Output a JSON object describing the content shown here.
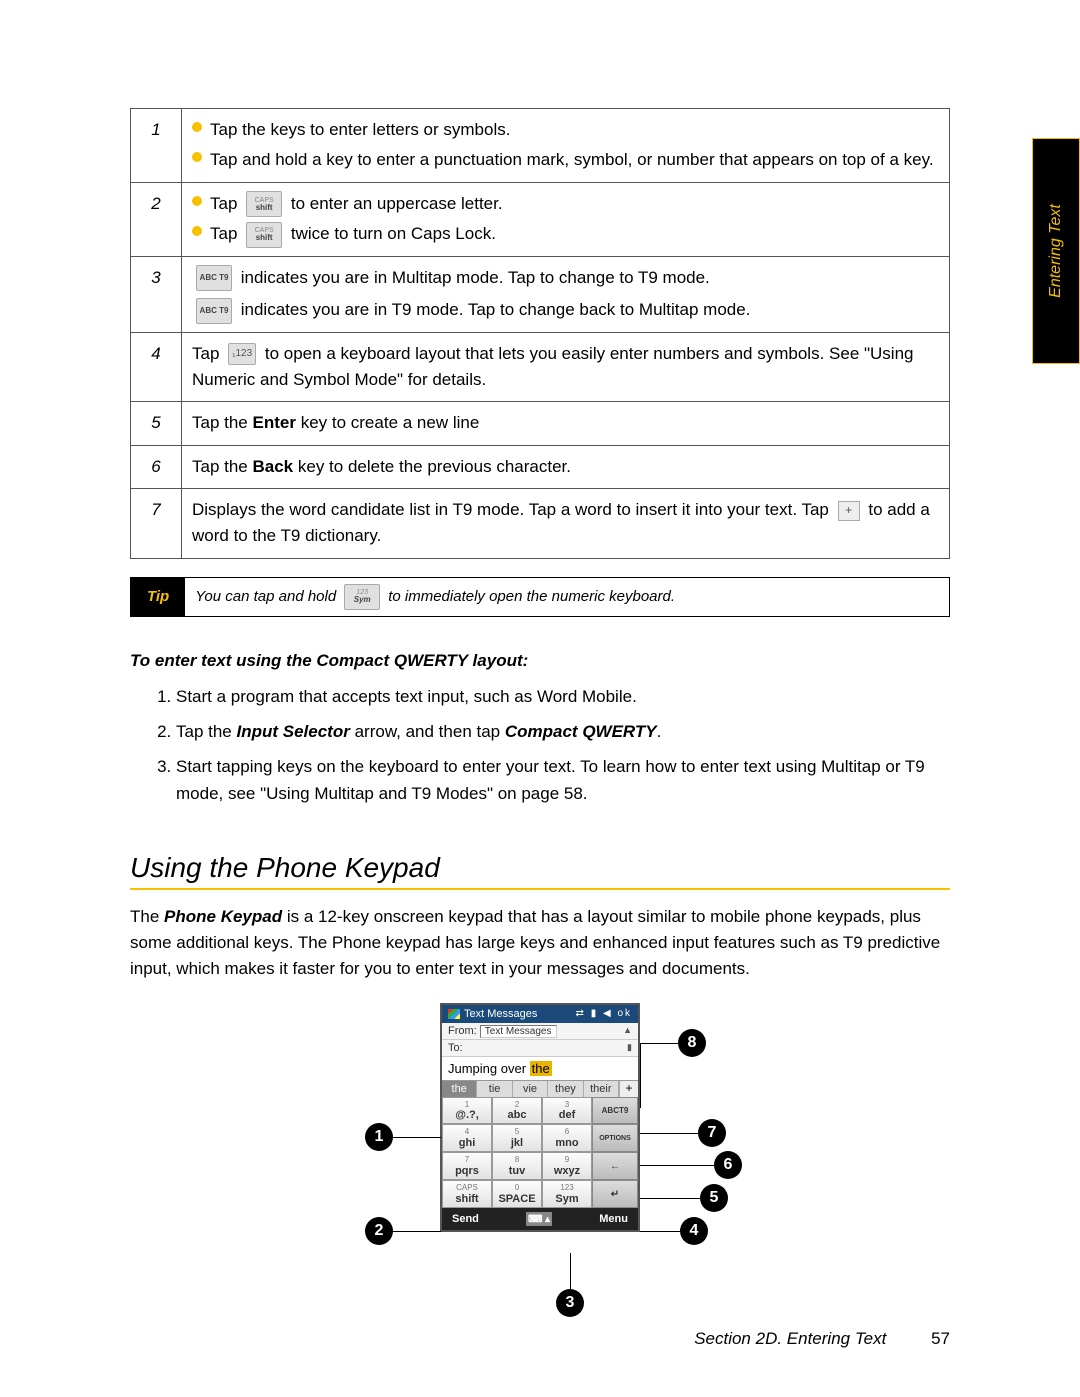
{
  "sidetab": "Entering Text",
  "table": {
    "rows": [
      {
        "num": "1",
        "bullets": [
          "Tap the keys to enter letters or symbols.",
          "Tap and hold a key to enter a punctuation mark, symbol, or number that appears on top of a key."
        ]
      },
      {
        "num": "2",
        "bullets_key": {
          "line1_pre": "Tap ",
          "key_top": "CAPS",
          "key_bot": "shift",
          "line1_post": " to enter an uppercase letter.",
          "line2_pre": "Tap ",
          "line2_post": " twice to turn on Caps Lock."
        }
      },
      {
        "num": "3",
        "mode": {
          "abc_label": "ABC T9",
          "line1": " indicates you are in Multitap mode. Tap to change to T9 mode.",
          "line2": " indicates you are in T9 mode. Tap to change back to Multitap mode."
        }
      },
      {
        "num": "4",
        "r4": {
          "pre": "Tap ",
          "key_label": "₁123",
          "mid": " to open a keyboard layout that lets you easily enter numbers and symbols. See \"Using Numeric and Symbol Mode\" for details."
        }
      },
      {
        "num": "5",
        "plain_pre": "Tap the ",
        "plain_b": "Enter",
        "plain_post": " key to create a new line"
      },
      {
        "num": "6",
        "plain_pre": "Tap the ",
        "plain_b": "Back",
        "plain_post": " key to delete the previous character."
      },
      {
        "num": "7",
        "r7": {
          "pre": "Displays the word candidate list in T9 mode. Tap a word to insert it into your text. Tap ",
          "plus": "+",
          "post": " to add a word to the T9 dictionary."
        }
      }
    ]
  },
  "tip": {
    "label": "Tip",
    "pre": "You can tap and hold ",
    "key_top": "123",
    "key_bot": "Sym",
    "post": " to immediately open the numeric keyboard."
  },
  "compact_heading": "To enter text using the Compact QWERTY layout:",
  "steps": [
    {
      "text": "Start a program that accepts text input, such as Word Mobile."
    },
    {
      "pre": "Tap the ",
      "b1": "Input Selector",
      "mid": " arrow, and then tap ",
      "b2": "Compact QWERTY",
      "post": "."
    },
    {
      "text": "Start tapping keys on the keyboard to enter your text. To learn how to enter text using Multitap or T9 mode, see \"Using Multitap and T9 Modes\" on page 58."
    }
  ],
  "section_heading": "Using the Phone Keypad",
  "section_para_pre": "The ",
  "section_para_b": "Phone Keypad",
  "section_para_post": " is a 12-key onscreen keypad that has a layout similar to mobile phone keypads, plus some additional keys. The Phone keypad has large keys and enhanced input features such as T9 predictive input, which makes it faster for you to enter text in your messages and documents.",
  "phone": {
    "title": "Text Messages",
    "status_icons": "⇄ ▮ ◀ ok",
    "from_label": "From:",
    "from_val": "Text Messages",
    "to_label": "To:",
    "entry_pre": "Jumping over ",
    "entry_hl": "the",
    "candidates": [
      "the",
      "tie",
      "vie",
      "they",
      "their"
    ],
    "plus": "+",
    "keys": [
      {
        "n": "1",
        "l": "@.?,"
      },
      {
        "n": "2",
        "l": "abc"
      },
      {
        "n": "3",
        "l": "def"
      },
      {
        "n": "4",
        "l": "ghi"
      },
      {
        "n": "5",
        "l": "jkl"
      },
      {
        "n": "6",
        "l": "mno"
      },
      {
        "n": "7",
        "l": "pqrs"
      },
      {
        "n": "8",
        "l": "tuv"
      },
      {
        "n": "9",
        "l": "wxyz"
      },
      {
        "n": "CAPS",
        "l": "shift"
      },
      {
        "n": "0",
        "l": "SPACE"
      },
      {
        "n": "123",
        "l": "Sym"
      }
    ],
    "side": [
      "ABCT9",
      "OPTIONS",
      "←",
      "↵"
    ],
    "bottom_left": "Send",
    "bottom_mid_icon": "⌨ ▴",
    "bottom_right": "Menu"
  },
  "callouts": [
    "1",
    "2",
    "3",
    "4",
    "5",
    "6",
    "7",
    "8"
  ],
  "footer": {
    "section": "Section 2D. Entering Text",
    "page": "57"
  }
}
